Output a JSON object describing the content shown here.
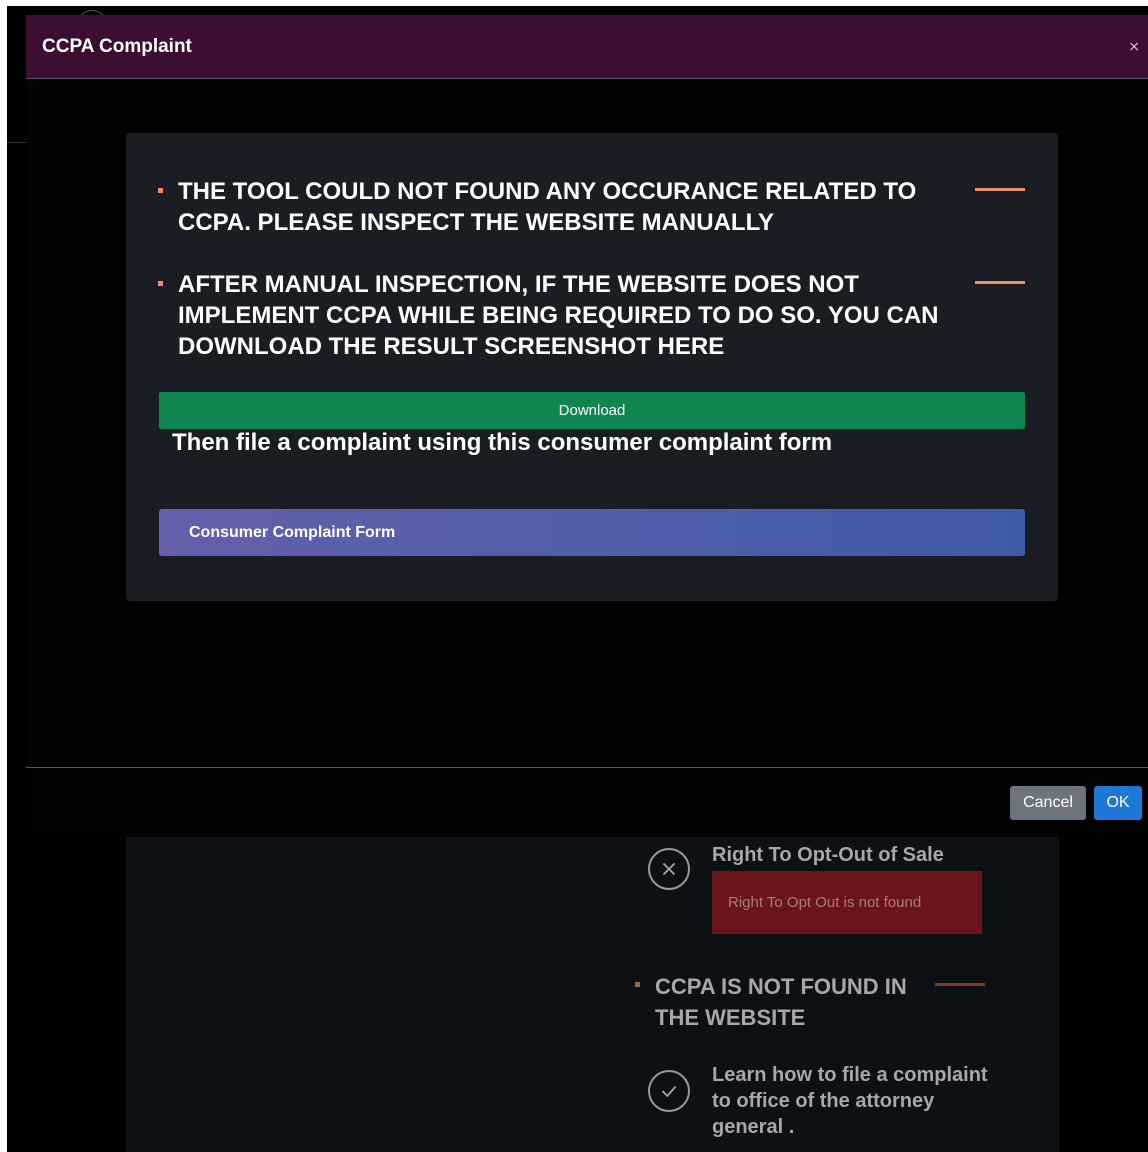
{
  "background": {
    "opt_out": {
      "title": "Right To Opt-Out of Sale",
      "alert": "Right To Opt Out is not found",
      "icon": "circle-x-icon"
    },
    "not_found_bullet": "CCPA IS NOT FOUND IN THE WEBSITE",
    "learn": {
      "text": "Learn how to file a complaint to office of the attorney general .",
      "icon": "circle-check-icon"
    }
  },
  "modal": {
    "title": "CCPA Complaint",
    "close_label": "×",
    "bullets": [
      "THE TOOL COULD NOT FOUND ANY OCCURANCE RELATED TO CCPA. PLEASE INSPECT THE WEBSITE MANUALLY",
      "AFTER MANUAL INSPECTION, IF THE WEBSITE DOES NOT IMPLEMENT CCPA WHILE BEING REQUIRED TO DO SO. YOU CAN DOWNLOAD THE RESULT SCREENSHOT HERE"
    ],
    "download_label": "Download",
    "subtext": "Then file a complaint using this consumer complaint form",
    "form_button_label": "Consumer Complaint Form",
    "cancel_label": "Cancel",
    "ok_label": "OK"
  },
  "colors": {
    "header_bg": "#3b0e32",
    "accent": "#f28b64",
    "download": "#0f8650",
    "ok": "#1e78d6",
    "cancel": "#6c757d",
    "alert": "#6b141c"
  }
}
